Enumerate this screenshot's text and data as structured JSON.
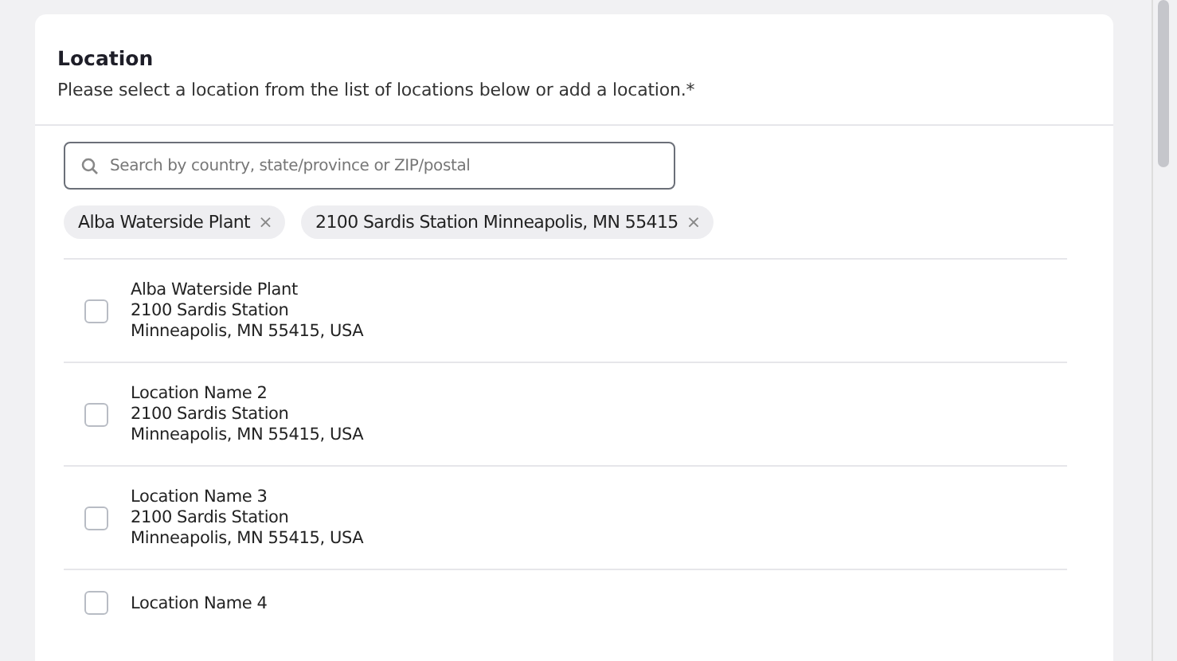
{
  "header": {
    "title": "Location",
    "description": "Please select a location from the list of locations below or add a location.*"
  },
  "search": {
    "placeholder": "Search by country, state/province or ZIP/postal"
  },
  "chips": [
    {
      "label": "Alba Waterside Plant",
      "remove": "×"
    },
    {
      "label": "2100 Sardis Station Minneapolis, MN 55415",
      "remove": "×"
    }
  ],
  "locations": [
    {
      "lines": [
        "Alba Waterside Plant",
        "2100 Sardis Station",
        "Minneapolis, MN 55415, USA"
      ],
      "checked": false
    },
    {
      "lines": [
        "Location Name 2",
        "2100 Sardis Station",
        "Minneapolis, MN 55415, USA"
      ],
      "checked": false
    },
    {
      "lines": [
        "Location Name 3",
        "2100 Sardis Station",
        "Minneapolis, MN 55415,  USA"
      ],
      "checked": false
    },
    {
      "lines": [
        "Location Name 4"
      ],
      "checked": false
    }
  ]
}
